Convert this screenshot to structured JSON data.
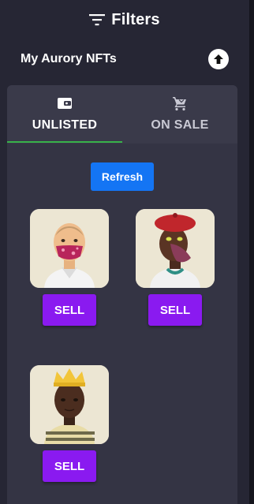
{
  "header": {
    "title": "Filters",
    "icon": "filter-icon"
  },
  "section": {
    "title": "My Aurory NFTs",
    "action_icon": "upload-arrow-icon"
  },
  "tabs": [
    {
      "label": "UNLISTED",
      "icon": "wallet-icon",
      "active": true
    },
    {
      "label": "ON SALE",
      "icon": "cart-icon",
      "active": false
    }
  ],
  "refresh_label": "Refresh",
  "nfts": [
    {
      "avatar": "bald-character-with-pink-mask",
      "sell_label": "SELL"
    },
    {
      "avatar": "character-with-red-beret-and-beak-mask",
      "sell_label": "SELL"
    },
    {
      "avatar": "character-with-gold-crown",
      "sell_label": "SELL"
    }
  ],
  "colors": {
    "panel": "#262634",
    "card": "#343444",
    "tab_active_underline": "#38b24a",
    "refresh": "#1475f4",
    "sell": "#8a1af0",
    "nft_bg": "#e9e3d0"
  }
}
